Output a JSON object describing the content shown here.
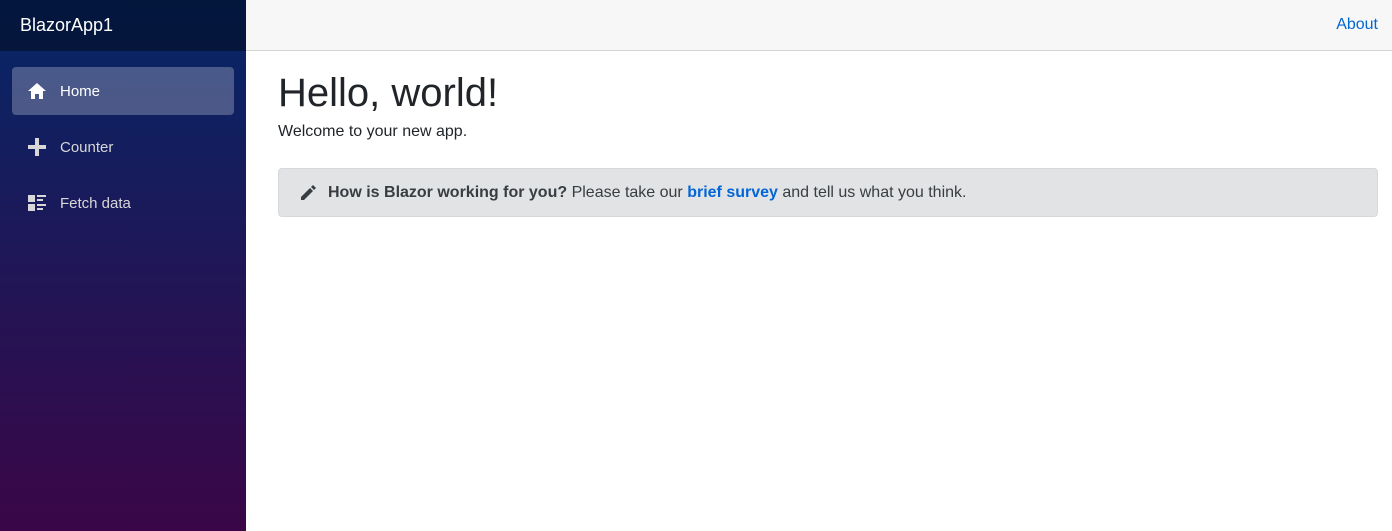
{
  "sidebar": {
    "brand": "BlazorApp1",
    "items": [
      {
        "label": "Home",
        "icon": "home-icon",
        "active": true
      },
      {
        "label": "Counter",
        "icon": "plus-icon",
        "active": false
      },
      {
        "label": "Fetch data",
        "icon": "list-rich-icon",
        "active": false
      }
    ]
  },
  "header": {
    "about_link": "About"
  },
  "main": {
    "title": "Hello, world!",
    "welcome": "Welcome to your new app.",
    "survey": {
      "icon": "pencil-icon",
      "question": "How is Blazor working for you?",
      "prefix": " Please take our ",
      "link": "brief survey",
      "suffix": " and tell us what you think."
    }
  },
  "colors": {
    "sidebar_top": "#052767",
    "sidebar_bottom": "#3a0647",
    "link": "#0366d6",
    "alert_bg": "#e2e3e5"
  }
}
